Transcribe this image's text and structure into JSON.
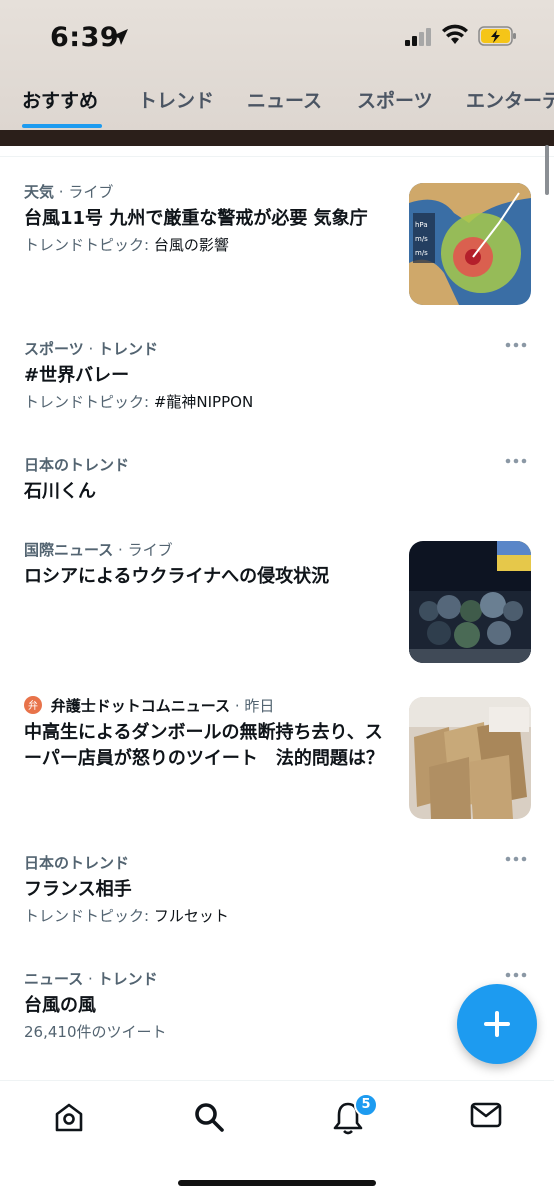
{
  "status_bar": {
    "time": "6:39"
  },
  "tabs": [
    {
      "label": "おすすめ",
      "active": true
    },
    {
      "label": "トレンド",
      "active": false
    },
    {
      "label": "ニュース",
      "active": false
    },
    {
      "label": "スポーツ",
      "active": false
    },
    {
      "label": "エンターテ",
      "active": false
    }
  ],
  "feed": [
    {
      "category": "天気",
      "context": "ライブ",
      "title": "台風11号 九州で厳重な警戒が必要 気象庁",
      "sub_prefix": "トレンドトピック: ",
      "sub_value": "台風の影響",
      "thumbnail": "typhoon-map"
    },
    {
      "category": "スポーツ",
      "context": "トレンド",
      "title": "#世界バレー",
      "sub_prefix": "トレンドトピック: ",
      "sub_value": "#龍神NIPPON"
    },
    {
      "category": "日本のトレンド",
      "title": "石川くん"
    },
    {
      "category": "国際ニュース",
      "context": "ライブ",
      "title": "ロシアによるウクライナへの侵攻状況",
      "thumbnail": "memorial-flowers"
    },
    {
      "category": "弁護士ドットコムニュース",
      "context": "昨日",
      "title": "中高生によるダンボールの無断持ち去り、スーパー店員が怒りのツイート　法的問題は？",
      "thumbnail": "cardboard-boxes"
    },
    {
      "category": "日本のトレンド",
      "title": "フランス相手",
      "sub_prefix": "トレンドトピック: ",
      "sub_value": "フルセット"
    },
    {
      "category": "ニュース",
      "context": "トレンド",
      "title": "台風の風",
      "sub_prefix": "26,410件のツイート",
      "sub_value": ""
    }
  ],
  "bottom_nav": {
    "notification_count": "5",
    "items": [
      "home-icon",
      "search-icon",
      "bell-icon",
      "mail-icon"
    ]
  },
  "colors": {
    "accent": "#1d9bf0",
    "secondary_text": "#536471"
  }
}
